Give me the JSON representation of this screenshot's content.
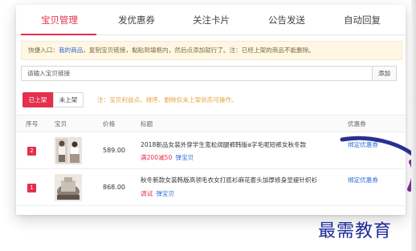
{
  "tabs": [
    {
      "label": "宝贝管理",
      "active": true
    },
    {
      "label": "发优惠券",
      "active": false
    },
    {
      "label": "关注卡片",
      "active": false
    },
    {
      "label": "公告发送",
      "active": false
    },
    {
      "label": "自动回复",
      "active": false
    }
  ],
  "notice": {
    "prefix": "快捷入口：",
    "link": "我的商品",
    "text": "，复制宝贝链接，黏贴到填框内，然后点添加就行了。注：已经上架的商品不能删除。"
  },
  "link_input": {
    "placeholder": "请输入宝贝链接"
  },
  "add_button": "添加",
  "filters": {
    "on_shelf": "已上架",
    "off_shelf": "未上架",
    "note": "注：宝贝利益点、排序、删除仅未上架状态可操作。"
  },
  "table": {
    "headers": [
      "序号",
      "宝贝",
      "价格",
      "标题",
      "优惠券"
    ],
    "rows": [
      {
        "index": "2",
        "price": "589.00",
        "title": "2018新品女装外穿学生宽松阔腿裤韩版a字毛呢短裤女秋冬款",
        "tag": "满200减50",
        "tag_link": "弹宝贝",
        "coupon": "绑定优惠券"
      },
      {
        "index": "1",
        "price": "868.00",
        "title": "秋冬新款女装韩版高领毛衣女打底衫麻花套头加厚修身显瘦针织衫",
        "tag": "调试",
        "tag_link": "弹宝贝",
        "coupon": "绑定优惠券"
      }
    ]
  },
  "watermark": "最需教育",
  "colors": {
    "accent": "#e62e4d",
    "link": "#2b6cd6",
    "notice_bg": "#fff7e3",
    "watermark": "#1e2a9c",
    "swoosh": "#7b2d8b"
  }
}
